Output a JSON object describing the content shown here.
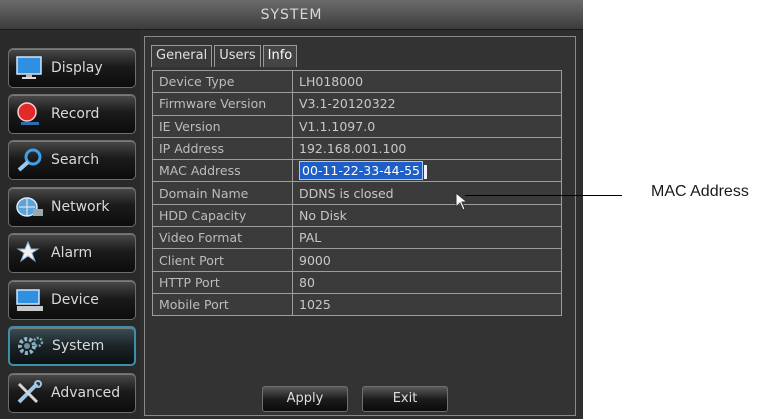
{
  "window": {
    "title": "SYSTEM"
  },
  "sidebar": {
    "items": [
      {
        "label": "Display",
        "icon": "monitor-icon"
      },
      {
        "label": "Record",
        "icon": "record-icon"
      },
      {
        "label": "Search",
        "icon": "magnifier-icon"
      },
      {
        "label": "Network",
        "icon": "network-icon"
      },
      {
        "label": "Alarm",
        "icon": "alarm-icon"
      },
      {
        "label": "Device",
        "icon": "device-icon"
      },
      {
        "label": "System",
        "icon": "gear-icon",
        "active": true
      },
      {
        "label": "Advanced",
        "icon": "tools-icon"
      }
    ]
  },
  "tabs": [
    {
      "label": "General"
    },
    {
      "label": "Users"
    },
    {
      "label": "Info",
      "active": true
    }
  ],
  "info": [
    {
      "key": "Device Type",
      "value": "LH018000"
    },
    {
      "key": "Firmware Version",
      "value": "V3.1-20120322"
    },
    {
      "key": "IE Version",
      "value": "V1.1.1097.0"
    },
    {
      "key": "IP Address",
      "value": "192.168.001.100"
    },
    {
      "key": "MAC Address",
      "value": "00-11-22-33-44-55"
    },
    {
      "key": "Domain Name",
      "value": "DDNS is closed"
    },
    {
      "key": "HDD Capacity",
      "value": "No Disk"
    },
    {
      "key": "Video Format",
      "value": "PAL"
    },
    {
      "key": "Client Port",
      "value": "9000"
    },
    {
      "key": "HTTP Port",
      "value": "80"
    },
    {
      "key": "Mobile Port",
      "value": "1025"
    }
  ],
  "buttons": {
    "apply": "Apply",
    "exit": "Exit"
  },
  "callout": {
    "label": "MAC Address"
  },
  "colors": {
    "highlight": "#1d5fc7",
    "active_border": "#3b8fa6",
    "panel_bg": "#333333"
  }
}
